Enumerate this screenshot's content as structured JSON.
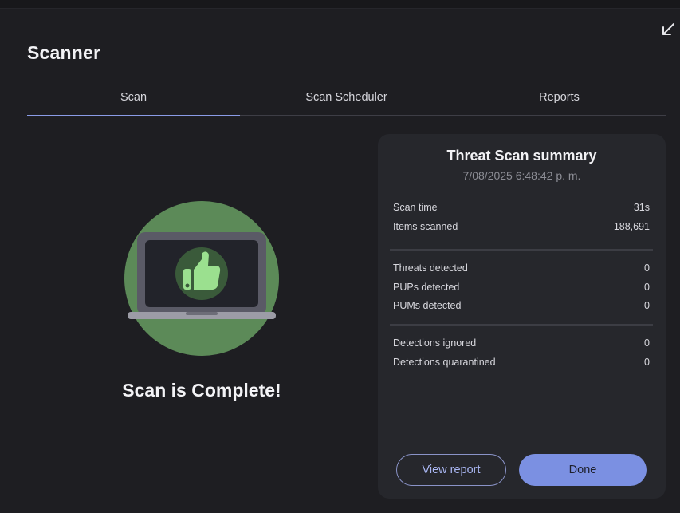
{
  "window": {
    "title": "Scanner"
  },
  "tabs": [
    {
      "label": "Scan",
      "active": true
    },
    {
      "label": "Scan Scheduler",
      "active": false
    },
    {
      "label": "Reports",
      "active": false
    }
  ],
  "status": {
    "message": "Scan is Complete!",
    "illustration": "laptop-thumbs-up-icon"
  },
  "summary": {
    "title": "Threat Scan summary",
    "date": "7/08/2025 6:48:42 p. m.",
    "group1": [
      {
        "label": "Scan time",
        "value": "31s"
      },
      {
        "label": "Items scanned",
        "value": "188,691"
      }
    ],
    "group2": [
      {
        "label": "Threats detected",
        "value": "0"
      },
      {
        "label": "PUPs detected",
        "value": "0"
      },
      {
        "label": "PUMs detected",
        "value": "0"
      }
    ],
    "group3": [
      {
        "label": "Detections ignored",
        "value": "0"
      },
      {
        "label": "Detections quarantined",
        "value": "0"
      }
    ]
  },
  "buttons": {
    "view_report": "View report",
    "done": "Done"
  },
  "colors": {
    "accent": "#7b90e2",
    "success_green": "#5c8a58",
    "background": "#1e1e22",
    "card": "#26272c"
  }
}
